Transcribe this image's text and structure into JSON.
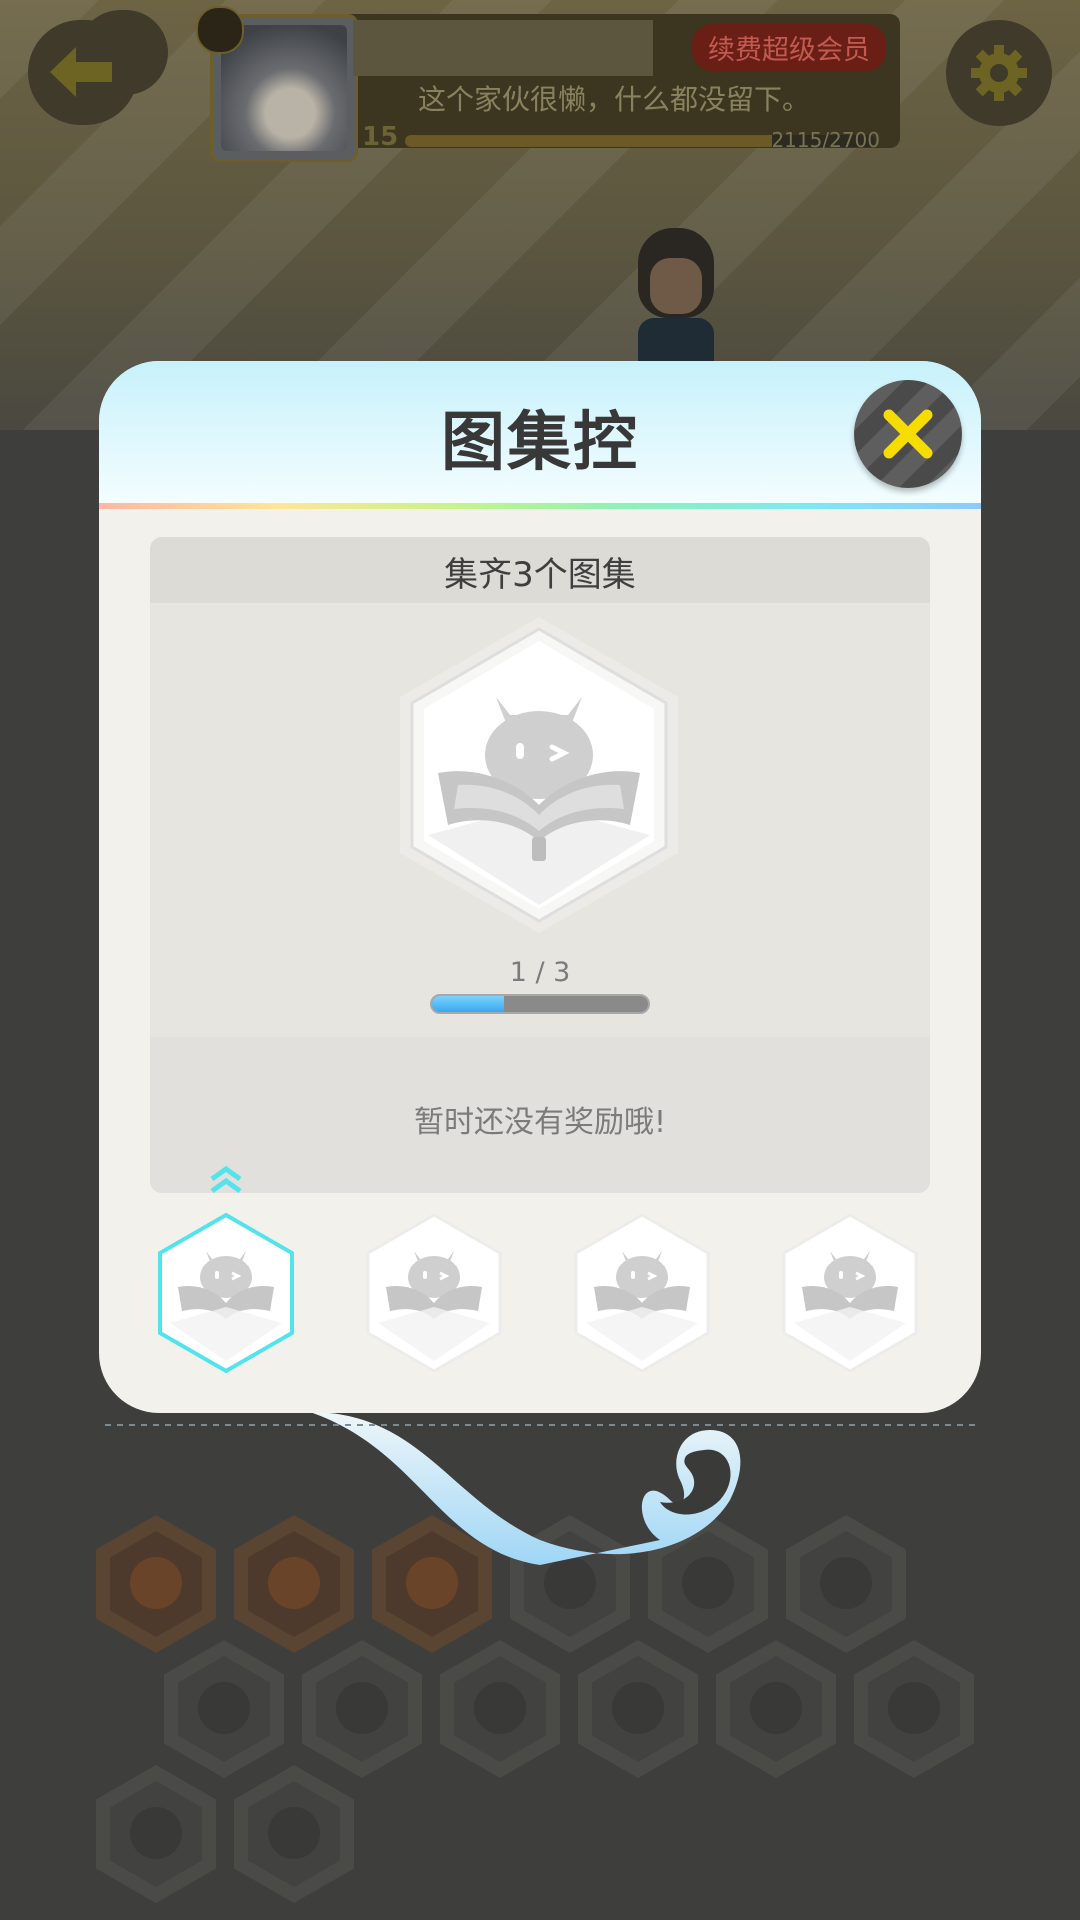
{
  "header": {
    "back_icon": "arrow-left-icon",
    "settings_icon": "gear-icon",
    "renew_label": "续费超级会员",
    "signature": "这个家伙很懒，什么都没留下。",
    "level": "15",
    "exp_text": "2115/2700",
    "exp_progress": 0.78
  },
  "modal": {
    "title": "图集控",
    "close_icon": "close-x-icon",
    "goal": "集齐3个图集",
    "progress_text": "1 / 3",
    "progress_value": 0.333,
    "reward_text": "暂时还没有奖励哦!",
    "tiers": [
      {
        "selected": true
      },
      {
        "selected": false
      },
      {
        "selected": false
      },
      {
        "selected": false
      }
    ]
  },
  "colors": {
    "accent_yellow": "#f7dc00",
    "progress_blue": "#39a8f0",
    "tier_selected": "#53e3ec"
  }
}
